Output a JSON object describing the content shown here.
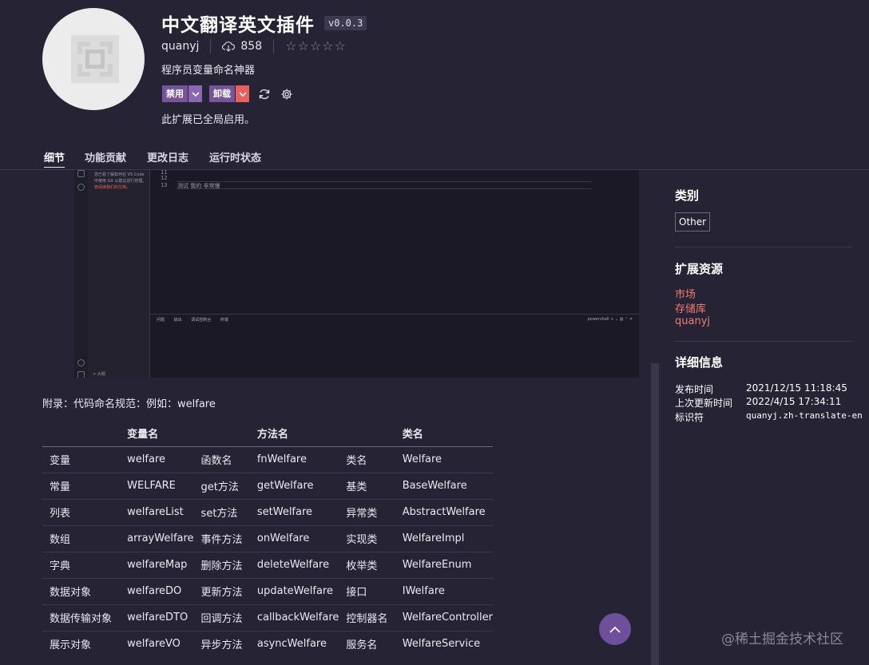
{
  "header": {
    "title": "中文翻译英文插件",
    "version": "v0.0.3",
    "publisher": "quanyj",
    "downloads": "858",
    "rating_stars": "☆☆☆☆☆",
    "description": "程序员变量命名神器",
    "disable_label": "禁用",
    "uninstall_label": "卸载",
    "status": "此扩展已全局启用。",
    "colors": {
      "accent": "#76539b",
      "danger": "#e8605c",
      "background": "#262335"
    }
  },
  "tabs": [
    {
      "label": "细节"
    },
    {
      "label": "功能贡献"
    },
    {
      "label": "更改日志"
    },
    {
      "label": "运行时状态"
    }
  ],
  "preview": {
    "sidebar_note_plain": "您已看了解如何在 VS Code 中使用 Git 以建议进行管理。",
    "sidebar_note_red": "表阅读我们的文档。",
    "line_numbers": [
      "11",
      "12",
      "13"
    ],
    "code_line": "测试  我的    非常慢",
    "panel_tabs": [
      "问题",
      "输出",
      "调试控制台",
      "终端"
    ],
    "panel_right": "powershell  + ⌄  ▥  ⌃  ✕",
    "sidebar_foot": "> 大纲"
  },
  "content": {
    "appendix": "附录：代码命名规范：例如：welfare",
    "table": {
      "headers": [
        "",
        "变量名",
        "",
        "方法名",
        "",
        "类名"
      ],
      "rows": [
        [
          "变量",
          "welfare",
          "函数名",
          "fnWelfare",
          "类名",
          "Welfare"
        ],
        [
          "常量",
          "WELFARE",
          "get方法",
          "getWelfare",
          "基类",
          "BaseWelfare"
        ],
        [
          "列表",
          "welfareList",
          "set方法",
          "setWelfare",
          "异常类",
          "AbstractWelfare"
        ],
        [
          "数组",
          "arrayWelfare",
          "事件方法",
          "onWelfare",
          "实现类",
          "WelfareImpl"
        ],
        [
          "字典",
          "welfareMap",
          "删除方法",
          "deleteWelfare",
          "枚举类",
          "WelfareEnum"
        ],
        [
          "数据对象",
          "welfareDO",
          "更新方法",
          "updateWelfare",
          "接口",
          "IWelfare"
        ],
        [
          "数据传输对象",
          "welfareDTO",
          "回调方法",
          "callbackWelfare",
          "控制器名",
          "WelfareController"
        ],
        [
          "展示对象",
          "welfareVO",
          "异步方法",
          "asyncWelfare",
          "服务名",
          "WelfareService"
        ]
      ]
    }
  },
  "sidebar": {
    "category_heading": "类别",
    "category_tag": "Other",
    "resources_heading": "扩展资源",
    "resources": [
      "市场",
      "存储库",
      "quanyj"
    ],
    "details_heading": "详细信息",
    "details": [
      {
        "key": "发布时间",
        "value": "2021/12/15 11:18:45"
      },
      {
        "key": "上次更新时间",
        "value": "2022/4/15 17:34:11"
      },
      {
        "key": "标识符",
        "value": "quanyj.zh-translate-en"
      }
    ]
  },
  "watermark": "@稀土掘金技术社区"
}
